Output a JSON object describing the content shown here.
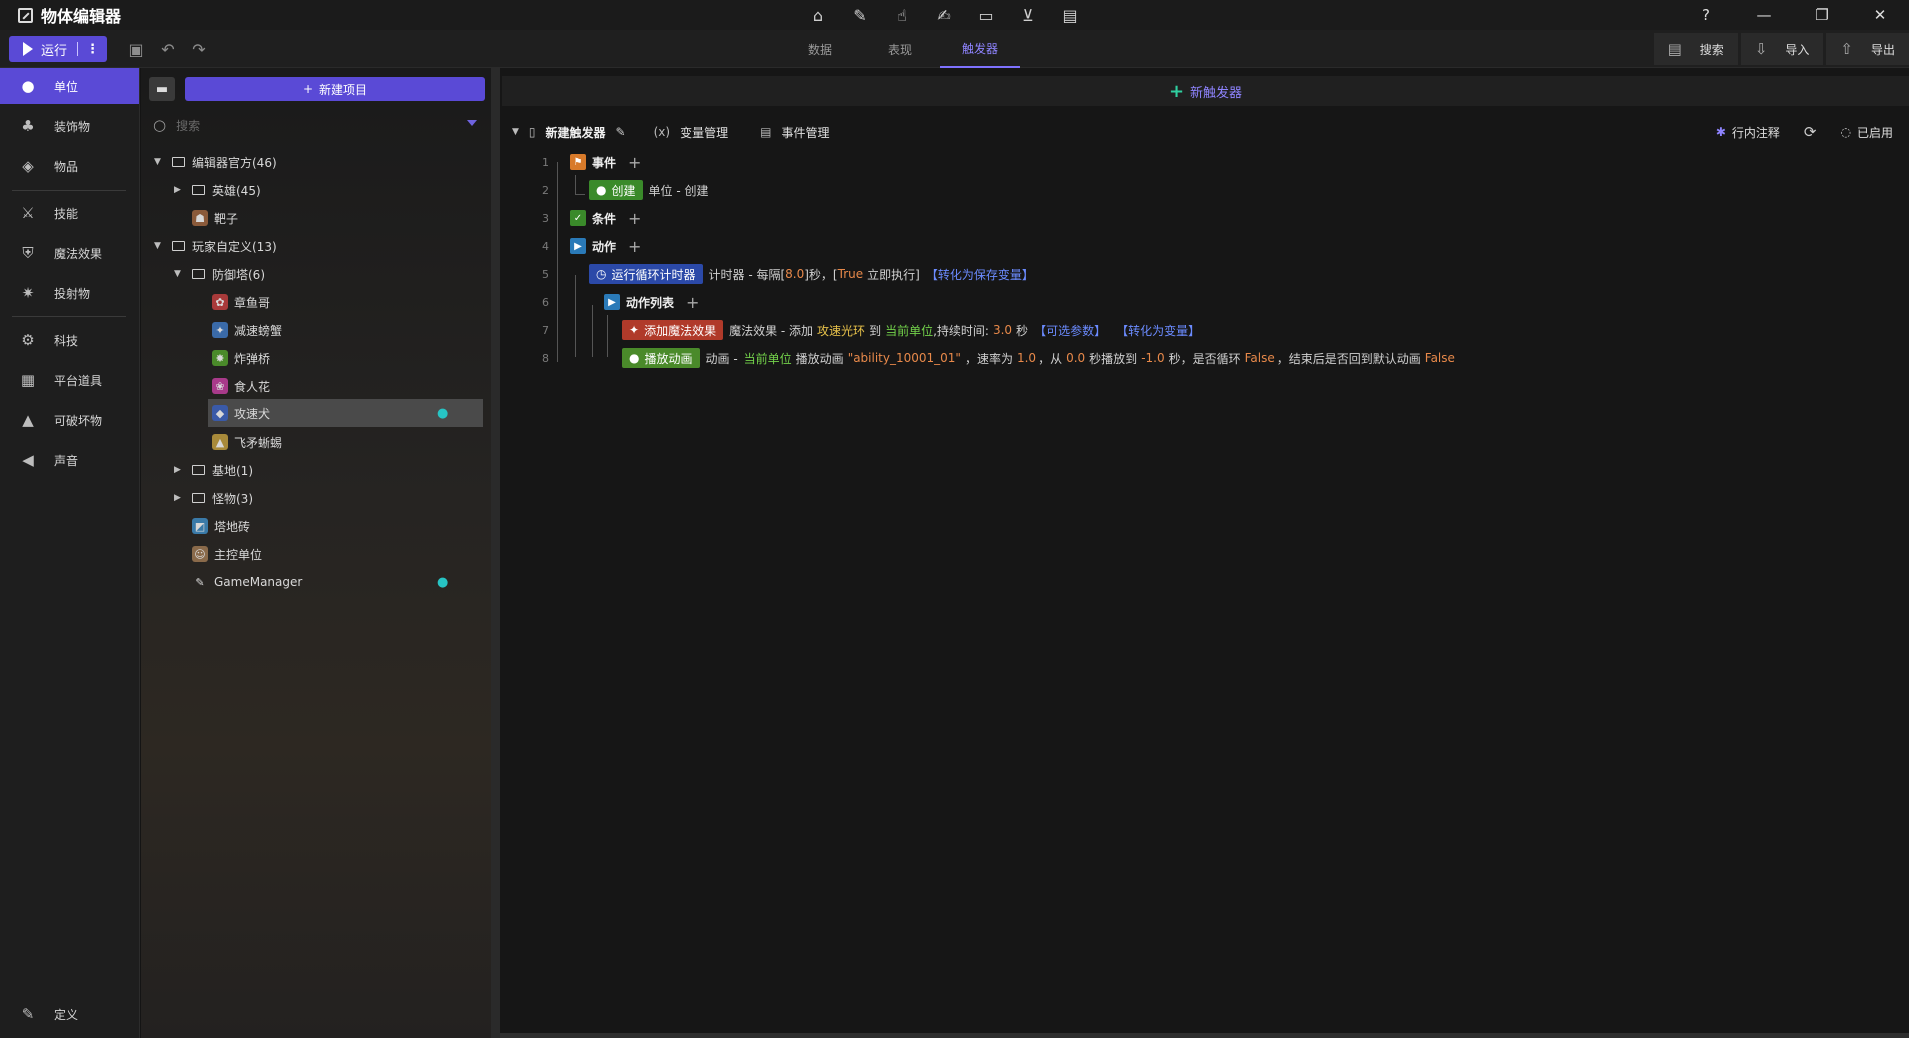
{
  "app": {
    "title": "物体编辑器"
  },
  "toolbar": {
    "run_label": "运行",
    "more": "⋮"
  },
  "tabs": [
    {
      "label": "数据"
    },
    {
      "label": "表现"
    },
    {
      "label": "触发器"
    }
  ],
  "top_right": {
    "search_label": "搜索",
    "import_label": "导入",
    "export_label": "导出"
  },
  "sidebar": {
    "items": [
      {
        "label": "单位",
        "icon": "user-icon"
      },
      {
        "label": "装饰物",
        "icon": "tree-icon"
      },
      {
        "label": "物品",
        "icon": "box-icon"
      },
      {
        "label": "技能",
        "icon": "sword-icon"
      },
      {
        "label": "魔法效果",
        "icon": "shield-icon"
      },
      {
        "label": "投射物",
        "icon": "projectile-icon"
      },
      {
        "label": "科技",
        "icon": "tech-icon"
      },
      {
        "label": "平台道具",
        "icon": "store-icon"
      },
      {
        "label": "可破坏物",
        "icon": "destructible-icon"
      },
      {
        "label": "声音",
        "icon": "speaker-icon"
      }
    ],
    "define_label": "定义"
  },
  "tree": {
    "new_item_label": "新建项目",
    "search_placeholder": "搜索",
    "nodes": [
      {
        "label": "编辑器官方(46)"
      },
      {
        "label": "英雄(45)"
      },
      {
        "label": "靶子"
      },
      {
        "label": "玩家自定义(13)"
      },
      {
        "label": "防御塔(6)"
      },
      {
        "label": "章鱼哥"
      },
      {
        "label": "减速螃蟹"
      },
      {
        "label": "炸弹桥"
      },
      {
        "label": "食人花"
      },
      {
        "label": "攻速犬"
      },
      {
        "label": "飞矛蜥蜴"
      },
      {
        "label": "基地(1)"
      },
      {
        "label": "怪物(3)"
      },
      {
        "label": "塔地砖"
      },
      {
        "label": "主控单位"
      },
      {
        "label": "GameManager"
      }
    ]
  },
  "main": {
    "new_trigger_label": "新触发器",
    "trigger_name": "新建触发器",
    "var_mgr": "变量管理",
    "var_mgr_prefix": "(x)",
    "event_mgr": "事件管理",
    "inline_comment": "行内注释",
    "enabled": "已启用",
    "lines": {
      "l1": {
        "num": "1",
        "kw": "事件"
      },
      "l2": {
        "num": "2",
        "tag": "创建",
        "text": "单位 - 创建"
      },
      "l3": {
        "num": "3",
        "kw": "条件"
      },
      "l4": {
        "num": "4",
        "kw": "动作"
      },
      "l5": {
        "num": "5",
        "tag": "运行循环计时器",
        "t1": "计时器 - 每隔[",
        "v1": "8.0",
        "t2": "]秒，[",
        "v2": "True",
        "t3": "立即执行]",
        "link": "【转化为保存变量】"
      },
      "l6": {
        "num": "6",
        "kw": "动作列表"
      },
      "l7": {
        "num": "7",
        "tag": "添加魔法效果",
        "t1": "魔法效果 - 添加",
        "v1": "攻速光环",
        "t2": "到",
        "v2": "当前单位",
        "t3": ",持续时间:",
        "v3": "3.0",
        "t4": "秒",
        "link1": "【可选参数】",
        "link2": "【转化为变量】"
      },
      "l8": {
        "num": "8",
        "tag": "播放动画",
        "t1": "动画 -",
        "v1": "当前单位",
        "t2": "播放动画",
        "v2": "\"ability_10001_01\"",
        "t3": "，速率为",
        "v3": "1.0",
        "t4": "，从",
        "v4": "0.0",
        "t5": "秒播放到",
        "v5": "-1.0",
        "t6": "秒，是否循环",
        "v6": "False",
        "t7": "，结束后是否回到默认动画",
        "v7": "False"
      }
    }
  }
}
